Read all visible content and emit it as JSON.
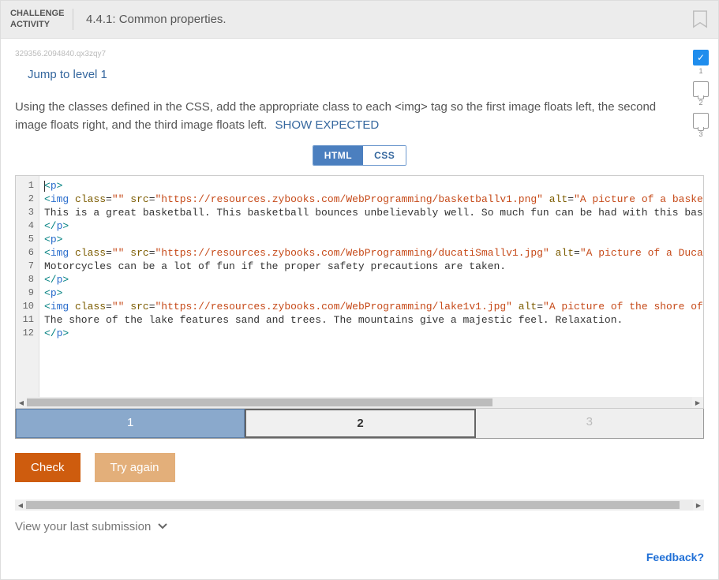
{
  "header": {
    "label_line1": "CHALLENGE",
    "label_line2": "ACTIVITY",
    "title": "4.4.1: Common properties."
  },
  "watermark": "329356.2094840.qx3zqy7",
  "jump_link": "Jump to level 1",
  "instructions": "Using the classes defined in the CSS, add the appropriate class to each <img> tag so the first image floats left, the second image floats right, and the third image floats left.",
  "show_expected": "SHOW EXPECTED",
  "tabs": {
    "html": "HTML",
    "css": "CSS"
  },
  "code": {
    "lines": [
      {
        "n": 1,
        "parts": [
          {
            "t": "cursor"
          },
          {
            "c": "tag-b",
            "s": "<"
          },
          {
            "c": "tag-n",
            "s": "p"
          },
          {
            "c": "tag-b",
            "s": ">"
          }
        ]
      },
      {
        "n": 2,
        "parts": [
          {
            "c": "txt",
            "s": "   "
          },
          {
            "c": "tag-b",
            "s": "<"
          },
          {
            "c": "tag-n",
            "s": "img"
          },
          {
            "c": "txt",
            "s": " "
          },
          {
            "c": "attr-n",
            "s": "class"
          },
          {
            "c": "attr-eq",
            "s": "="
          },
          {
            "c": "attr-v",
            "s": "\"\""
          },
          {
            "c": "txt",
            "s": " "
          },
          {
            "c": "attr-n",
            "s": "src"
          },
          {
            "c": "attr-eq",
            "s": "="
          },
          {
            "c": "attr-v",
            "s": "\"https://resources.zybooks.com/WebProgramming/basketballv1.png\""
          },
          {
            "c": "txt",
            "s": " "
          },
          {
            "c": "attr-n",
            "s": "alt"
          },
          {
            "c": "attr-eq",
            "s": "="
          },
          {
            "c": "attr-v",
            "s": "\"A picture of a basket"
          }
        ]
      },
      {
        "n": 3,
        "parts": [
          {
            "c": "txt",
            "s": "   This is a great basketball. This basketball bounces unbelievably well. So much fun can be had with this bask"
          }
        ]
      },
      {
        "n": 4,
        "parts": [
          {
            "c": "tag-b",
            "s": "</"
          },
          {
            "c": "tag-n",
            "s": "p"
          },
          {
            "c": "tag-b",
            "s": ">"
          }
        ]
      },
      {
        "n": 5,
        "parts": [
          {
            "c": "tag-b",
            "s": "<"
          },
          {
            "c": "tag-n",
            "s": "p"
          },
          {
            "c": "tag-b",
            "s": ">"
          }
        ]
      },
      {
        "n": 6,
        "parts": [
          {
            "c": "txt",
            "s": "   "
          },
          {
            "c": "tag-b",
            "s": "<"
          },
          {
            "c": "tag-n",
            "s": "img"
          },
          {
            "c": "txt",
            "s": " "
          },
          {
            "c": "attr-n",
            "s": "class"
          },
          {
            "c": "attr-eq",
            "s": "="
          },
          {
            "c": "attr-v",
            "s": "\"\""
          },
          {
            "c": "txt",
            "s": " "
          },
          {
            "c": "attr-n",
            "s": "src"
          },
          {
            "c": "attr-eq",
            "s": "="
          },
          {
            "c": "attr-v",
            "s": "\"https://resources.zybooks.com/WebProgramming/ducatiSmallv1.jpg\""
          },
          {
            "c": "txt",
            "s": " "
          },
          {
            "c": "attr-n",
            "s": "alt"
          },
          {
            "c": "attr-eq",
            "s": "="
          },
          {
            "c": "attr-v",
            "s": "\"A picture of a Ducat"
          }
        ]
      },
      {
        "n": 7,
        "parts": [
          {
            "c": "txt",
            "s": "   Motorcycles can be a lot of fun if the proper safety precautions are taken."
          }
        ]
      },
      {
        "n": 8,
        "parts": [
          {
            "c": "tag-b",
            "s": "</"
          },
          {
            "c": "tag-n",
            "s": "p"
          },
          {
            "c": "tag-b",
            "s": ">"
          }
        ]
      },
      {
        "n": 9,
        "parts": [
          {
            "c": "tag-b",
            "s": "<"
          },
          {
            "c": "tag-n",
            "s": "p"
          },
          {
            "c": "tag-b",
            "s": ">"
          }
        ]
      },
      {
        "n": 10,
        "parts": [
          {
            "c": "txt",
            "s": "   "
          },
          {
            "c": "tag-b",
            "s": "<"
          },
          {
            "c": "tag-n",
            "s": "img"
          },
          {
            "c": "txt",
            "s": " "
          },
          {
            "c": "attr-n",
            "s": "class"
          },
          {
            "c": "attr-eq",
            "s": "="
          },
          {
            "c": "attr-v",
            "s": "\"\""
          },
          {
            "c": "txt",
            "s": " "
          },
          {
            "c": "attr-n",
            "s": "src"
          },
          {
            "c": "attr-eq",
            "s": "="
          },
          {
            "c": "attr-v",
            "s": "\"https://resources.zybooks.com/WebProgramming/lake1v1.jpg\""
          },
          {
            "c": "txt",
            "s": " "
          },
          {
            "c": "attr-n",
            "s": "alt"
          },
          {
            "c": "attr-eq",
            "s": "="
          },
          {
            "c": "attr-v",
            "s": "\"A picture of the shore of"
          }
        ]
      },
      {
        "n": 11,
        "parts": [
          {
            "c": "txt",
            "s": "   The shore of the lake features sand and trees. The mountains give a majestic feel. Relaxation."
          }
        ]
      },
      {
        "n": 12,
        "parts": [
          {
            "c": "tag-b",
            "s": "</"
          },
          {
            "c": "tag-n",
            "s": "p"
          },
          {
            "c": "tag-b",
            "s": ">"
          }
        ]
      }
    ]
  },
  "levels": [
    {
      "label": "1",
      "state": "done"
    },
    {
      "label": "2",
      "state": "active"
    },
    {
      "label": "3",
      "state": "inactive"
    }
  ],
  "buttons": {
    "check": "Check",
    "try_again": "Try again"
  },
  "view_last": "View your last submission",
  "feedback": "Feedback?",
  "progress": [
    {
      "n": "1",
      "done": true
    },
    {
      "n": "2",
      "done": false
    },
    {
      "n": "3",
      "done": false
    }
  ]
}
